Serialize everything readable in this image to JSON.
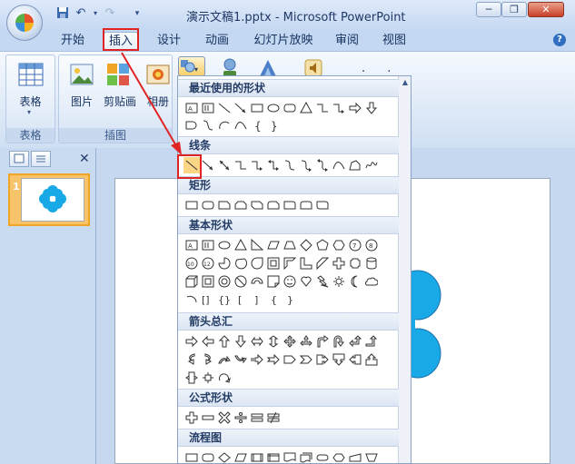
{
  "window": {
    "title": "演示文稿1.pptx - Microsoft PowerPoint",
    "controls": [
      "minimize",
      "restore",
      "close"
    ]
  },
  "quick_access": [
    "save-icon",
    "undo-icon",
    "redo-icon",
    "customize-icon"
  ],
  "tabs": [
    {
      "label": "开始"
    },
    {
      "label": "插入",
      "active": true
    },
    {
      "label": "设计"
    },
    {
      "label": "动画"
    },
    {
      "label": "幻灯片放映"
    },
    {
      "label": "审阅"
    },
    {
      "label": "视图"
    }
  ],
  "ribbon": {
    "groups": [
      {
        "label": "表格",
        "buttons": [
          {
            "label": "表格",
            "icon": "table-icon"
          }
        ]
      },
      {
        "label": "插图",
        "buttons": [
          {
            "label": "图片",
            "icon": "picture-icon"
          },
          {
            "label": "剪贴画",
            "icon": "clipart-icon"
          },
          {
            "label": "相册",
            "icon": "album-icon"
          }
        ]
      }
    ],
    "extra_icons": [
      "shapes-icon",
      "smartart-icon",
      "chart-icon",
      "sound-icon"
    ],
    "extra_text": ". ."
  },
  "shapes_gallery": {
    "sections": [
      {
        "label": "最近使用的形状"
      },
      {
        "label": "线条"
      },
      {
        "label": "矩形"
      },
      {
        "label": "基本形状"
      },
      {
        "label": "箭头总汇"
      },
      {
        "label": "公式形状"
      },
      {
        "label": "流程图"
      }
    ],
    "highlighted_shape": "straight-line"
  },
  "slides_pane": {
    "slide_number": "1"
  },
  "colors": {
    "accent": "#e02424",
    "shape_fill": "#19a9e7",
    "ribbon_bg": "#dbe7f7"
  }
}
